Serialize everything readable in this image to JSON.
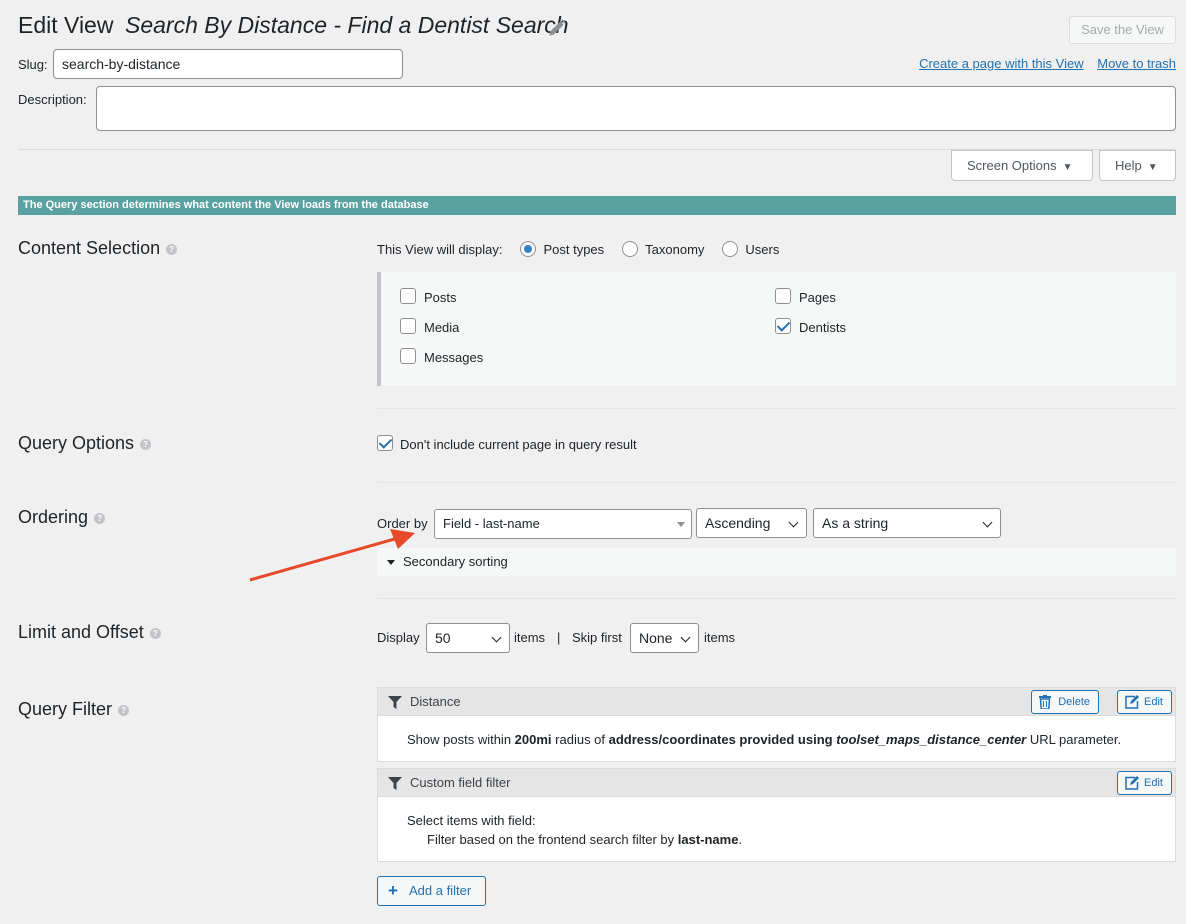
{
  "header": {
    "title": "Edit View",
    "view_name": "Search By Distance - Find a Dentist Search",
    "save_label": "Save the View",
    "slug_label": "Slug:",
    "slug_value": "search-by-distance",
    "description_label": "Description:",
    "description_value": "",
    "create_page_link": "Create a page with this View",
    "trash_link": "Move to trash",
    "screen_options": "Screen Options",
    "help": "Help"
  },
  "banner": "The Query section determines what content the View loads from the database",
  "content_selection": {
    "title": "Content Selection",
    "display_label": "This View will display:",
    "options": [
      {
        "label": "Post types",
        "selected": true
      },
      {
        "label": "Taxonomy",
        "selected": false
      },
      {
        "label": "Users",
        "selected": false
      }
    ],
    "post_types": [
      {
        "label": "Posts",
        "checked": false
      },
      {
        "label": "Pages",
        "checked": false
      },
      {
        "label": "Media",
        "checked": false
      },
      {
        "label": "Dentists",
        "checked": true
      },
      {
        "label": "Messages",
        "checked": false
      }
    ]
  },
  "query_options": {
    "title": "Query Options",
    "exclude_current_label": "Don't include current page in query result",
    "exclude_current_checked": true
  },
  "ordering": {
    "title": "Ordering",
    "order_by_label": "Order by",
    "order_by_value": "Field - last-name",
    "direction_value": "Ascending",
    "as_value": "As a string",
    "secondary_label": "Secondary sorting"
  },
  "limit_offset": {
    "title": "Limit and Offset",
    "display_label": "Display",
    "display_value": "50",
    "items_label": "items",
    "divider": "|",
    "skip_label": "Skip first",
    "skip_value": "None",
    "items_label2": "items"
  },
  "query_filter": {
    "title": "Query Filter",
    "delete_label": "Delete",
    "edit_label": "Edit",
    "distance": {
      "name": "Distance",
      "text_1": "Show posts within ",
      "radius": "200mi",
      "text_2": " radius of ",
      "source": "address/coordinates provided using ",
      "param": "toolset_maps_distance_center",
      "text_3": " URL parameter."
    },
    "custom_field": {
      "name": "Custom field filter",
      "line1": "Select items with field:",
      "line2_prefix": "Filter based on the frontend search filter by ",
      "field": "last-name",
      "line2_suffix": "."
    },
    "add_filter_label": "Add a filter"
  },
  "colors": {
    "accent": "#2271b1",
    "banner": "#5aa1a1",
    "arrow": "#e8492b"
  }
}
